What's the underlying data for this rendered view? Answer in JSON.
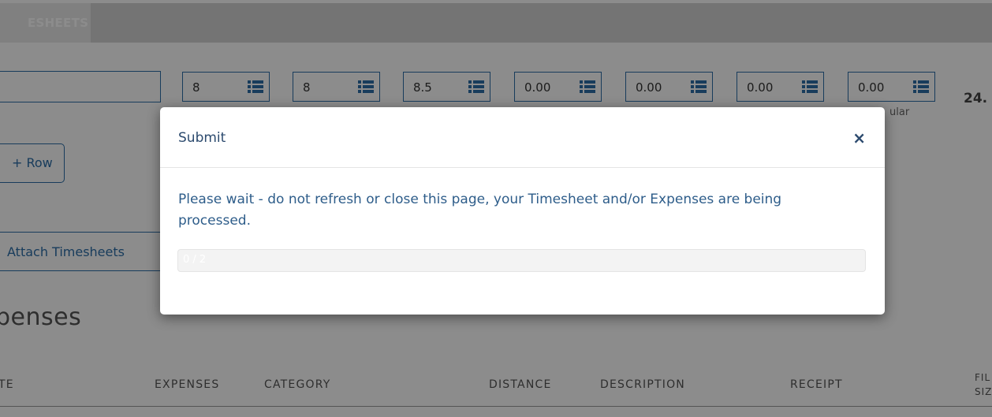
{
  "nav": {
    "active_tab": "ESHEETS"
  },
  "hours": [
    "8",
    "8",
    "8.5",
    "0.00",
    "0.00",
    "0.00",
    "0.00"
  ],
  "hours_total": "24.",
  "hours_sublabel": "ular",
  "buttons": {
    "add_row": "+ Row",
    "attach_timesheets": "Attach Timesheets"
  },
  "expenses_section": {
    "title": "penses",
    "columns": [
      "TE",
      "EXPENSES",
      "CATEGORY",
      "DISTANCE",
      "DESCRIPTION",
      "RECEIPT"
    ],
    "file_size_col": [
      "FIL",
      "SIZ"
    ]
  },
  "modal": {
    "title": "Submit",
    "close_symbol": "×",
    "message": "Please wait - do not refresh or close this page, your Timesheet and/or Expenses are being processed.",
    "progress_label": "0 / 2",
    "progress_fraction": 0
  },
  "colors": {
    "accent": "#2d6ea8",
    "modal_text": "#2e5d8a",
    "overlay": "rgba(0,0,0,0.45)"
  },
  "icons": {
    "hour_field": "list-icon",
    "close": "close-icon"
  }
}
